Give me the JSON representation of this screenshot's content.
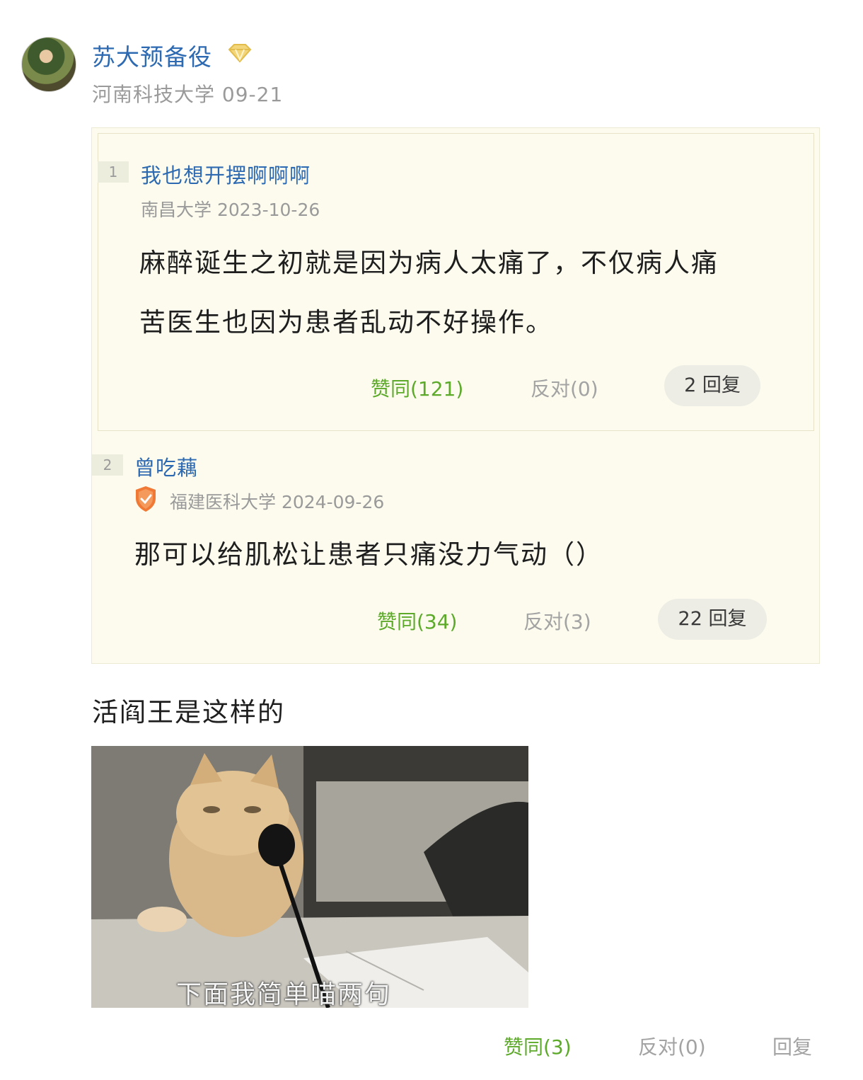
{
  "post": {
    "author": {
      "name": "苏大预备役",
      "badge_icon": "gem-badge-icon",
      "school": "河南科技大学",
      "date": "09-21"
    },
    "quote": [
      {
        "floor": "1",
        "author": "我也想开摆啊啊啊",
        "school": "南昌大学",
        "date": "2023-10-26",
        "text_lines": [
          "麻醉诞生之初就是因为病人太痛了，不仅病人痛",
          "苦医生也因为患者乱动不好操作。"
        ],
        "agree_label": "赞同(121)",
        "oppose_label": "反对(0)",
        "reply_label": "2 回复"
      },
      {
        "floor": "2",
        "author": "曾吃藕",
        "verified_icon": "shield-check-icon",
        "school": "福建医科大学",
        "date": "2024-09-26",
        "text": "那可以给肌松让患者只痛没力气动（）",
        "agree_label": "赞同(34)",
        "oppose_label": "反对(3)",
        "reply_label": "22 回复"
      }
    ],
    "body_text": "活阎王是这样的",
    "image_caption": "下面我简单喵两句",
    "actions": {
      "agree_label": "赞同(3)",
      "oppose_label": "反对(0)",
      "reply_label": "回复"
    },
    "colors": {
      "link_blue": "#2e6ab1",
      "agree_green": "#5daa2b",
      "quote_bg": "#fcfbee",
      "meta_gray": "#9a9a9a"
    }
  }
}
